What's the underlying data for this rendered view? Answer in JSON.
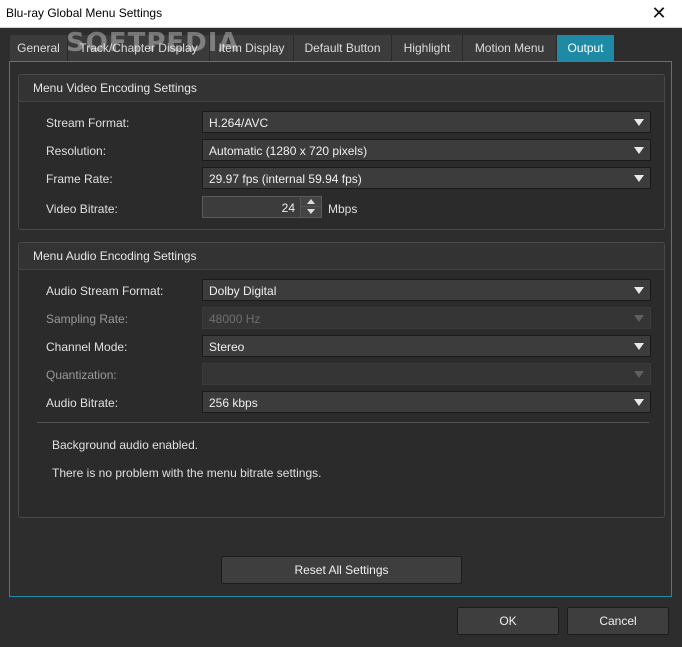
{
  "window": {
    "title": "Blu-ray Global Menu Settings",
    "close_glyph": "✕"
  },
  "tabs": [
    {
      "label": "General"
    },
    {
      "label": "Track/Chapter Display"
    },
    {
      "label": "Item Display"
    },
    {
      "label": "Default Button"
    },
    {
      "label": "Highlight"
    },
    {
      "label": "Motion Menu"
    },
    {
      "label": "Output",
      "active": true
    }
  ],
  "watermark": "SOFTPEDIA",
  "video": {
    "title": "Menu Video Encoding Settings",
    "stream_format": {
      "label": "Stream Format:",
      "value": "H.264/AVC"
    },
    "resolution": {
      "label": "Resolution:",
      "value": "Automatic (1280 x 720 pixels)"
    },
    "frame_rate": {
      "label": "Frame Rate:",
      "value": "29.97 fps (internal 59.94 fps)"
    },
    "bitrate": {
      "label": "Video Bitrate:",
      "value": "24",
      "unit": "Mbps"
    }
  },
  "audio": {
    "title": "Menu Audio Encoding Settings",
    "stream_format": {
      "label": "Audio Stream Format:",
      "value": "Dolby Digital"
    },
    "sampling_rate": {
      "label": "Sampling Rate:",
      "value": "48000  Hz"
    },
    "channel_mode": {
      "label": "Channel Mode:",
      "value": "Stereo"
    },
    "quantization": {
      "label": "Quantization:",
      "value": ""
    },
    "bitrate": {
      "label": "Audio Bitrate:",
      "value": "256 kbps"
    }
  },
  "messages": {
    "line1": "Background audio enabled.",
    "line2": "There is no problem with the menu bitrate settings."
  },
  "buttons": {
    "reset": "Reset All Settings",
    "ok": "OK",
    "cancel": "Cancel"
  },
  "colors": {
    "accent": "#1f8aa6",
    "background": "#2d2d2d"
  }
}
